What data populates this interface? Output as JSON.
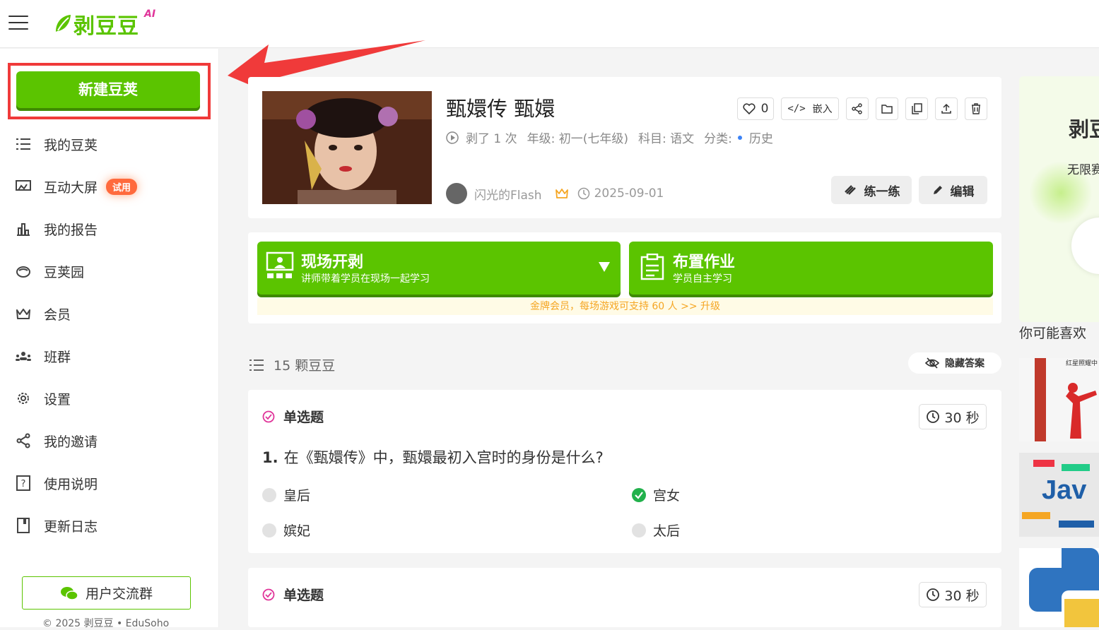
{
  "header": {
    "logo_text": "剥豆豆",
    "logo_ai": "AI"
  },
  "sidebar": {
    "new_button": "新建豆荚",
    "items": [
      {
        "label": "我的豆荚",
        "icon": "list-icon"
      },
      {
        "label": "互动大屏",
        "icon": "screen-icon",
        "badge": "试用"
      },
      {
        "label": "我的报告",
        "icon": "bar-chart-icon"
      },
      {
        "label": "豆荚园",
        "icon": "cloud-icon"
      },
      {
        "label": "会员",
        "icon": "crown-icon"
      },
      {
        "label": "班群",
        "icon": "group-icon"
      },
      {
        "label": "设置",
        "icon": "gear-icon"
      },
      {
        "label": "我的邀请",
        "icon": "share-icon"
      },
      {
        "label": "使用说明",
        "icon": "help-icon"
      },
      {
        "label": "更新日志",
        "icon": "book-icon"
      }
    ],
    "group_button": "用户交流群",
    "copyright": "© 2025 剥豆豆 • EduSoho"
  },
  "detail": {
    "title": "甄嬛传 甄嬛",
    "play_count": "剥了 1 次",
    "grade": "年级: 初一(七年级)",
    "subject": "科目: 语文",
    "category_label": "分类:",
    "category": "历史",
    "likes": "0",
    "embed": "嵌入",
    "author": "闪光的Flash",
    "date": "2025-09-01",
    "practice_button": "练一练",
    "edit_button": "编辑"
  },
  "actions": {
    "live": {
      "title": "现场开剥",
      "subtitle": "讲师带着学员在现场一起学习"
    },
    "homework": {
      "title": "布置作业",
      "subtitle": "学员自主学习"
    },
    "notice": "金牌会员，每场游戏可支持 60 人 >> 升级"
  },
  "questions_header": {
    "count": "15 颗豆豆",
    "hide_answers": "隐藏答案"
  },
  "questions": [
    {
      "type": "单选题",
      "time": "30 秒",
      "number": "1.",
      "text": "在《甄嬛传》中，甄嬛最初入宫时的身份是什么?",
      "options": [
        "皇后",
        "宫女",
        "嫔妃",
        "太后"
      ],
      "correct": "宫女"
    },
    {
      "type": "单选题",
      "time": "30 秒"
    }
  ],
  "right": {
    "panel_title": "剥豆",
    "panel_sub": "无限赛",
    "recommend_title": "你可能喜欢",
    "rec1_text": "红星照耀中",
    "rec2_text": "Jav"
  },
  "colors": {
    "brand_green": "#5bc400",
    "highlight_red": "#f03a3a",
    "badge_orange": "#ff6a3d",
    "pink_accent": "#e0359a"
  }
}
